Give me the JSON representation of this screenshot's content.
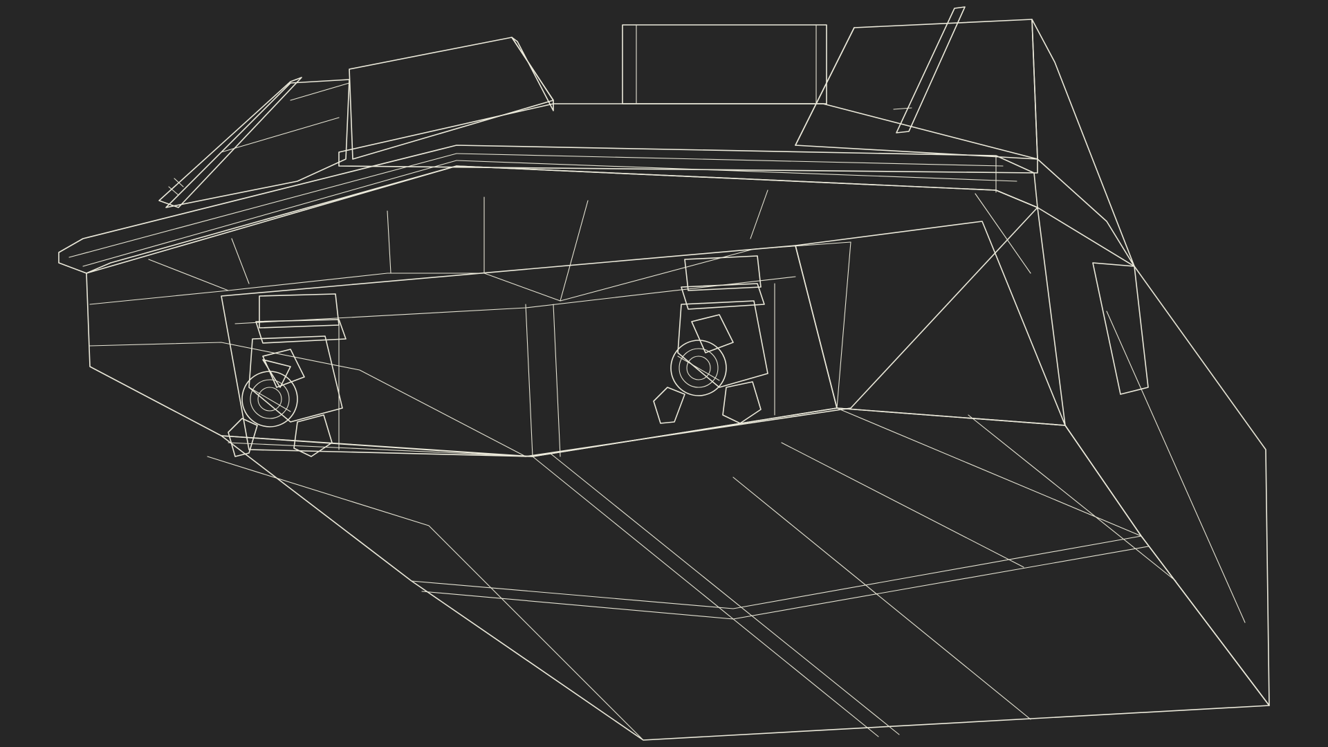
{
  "scene": {
    "subject": "boat-hull-wireframe-render",
    "colors": {
      "background": "#262626",
      "surface_light": "#7c7d70",
      "surface_mid": "#6f7064",
      "surface_dark": "#55564d",
      "wireframe": "#eceadb"
    },
    "propellers": [
      {
        "side": "left",
        "blades": 3
      },
      {
        "side": "right",
        "blades": 3
      }
    ]
  }
}
